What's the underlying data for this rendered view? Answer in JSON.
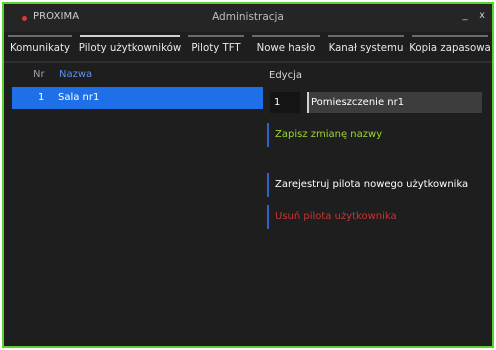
{
  "window": {
    "app_name": "PROXIMA",
    "title": "Administracja",
    "minimize_glyph": "_",
    "close_glyph": "x"
  },
  "tabs": [
    {
      "label": "Komunikaty",
      "active": false
    },
    {
      "label": "Piloty użytkowników",
      "active": true
    },
    {
      "label": "Piloty TFT",
      "active": false
    },
    {
      "label": "Nowe hasło",
      "active": false
    },
    {
      "label": "Kanał systemu",
      "active": false
    },
    {
      "label": "Kopia zapasowa",
      "active": false
    }
  ],
  "list": {
    "headers": {
      "nr": "Nr",
      "name": "Nazwa"
    },
    "rows": [
      {
        "nr": "1",
        "name": "Sala nr1",
        "selected": true
      }
    ]
  },
  "edit": {
    "heading": "Edycja",
    "nr_value": "1",
    "name_value": "Pomieszczenie nr1",
    "save_label": "Zapisz zmianę nazwy",
    "register_label": "Zarejestruj pilota nowego użytkownika",
    "remove_label": "Usuń pilota użytkownika"
  },
  "colors": {
    "accent_border": "#5ccf33",
    "selection": "#1f6fe8",
    "save_text": "#9bd92e",
    "remove_text": "#c93434",
    "action_marker": "#2f63c9"
  }
}
